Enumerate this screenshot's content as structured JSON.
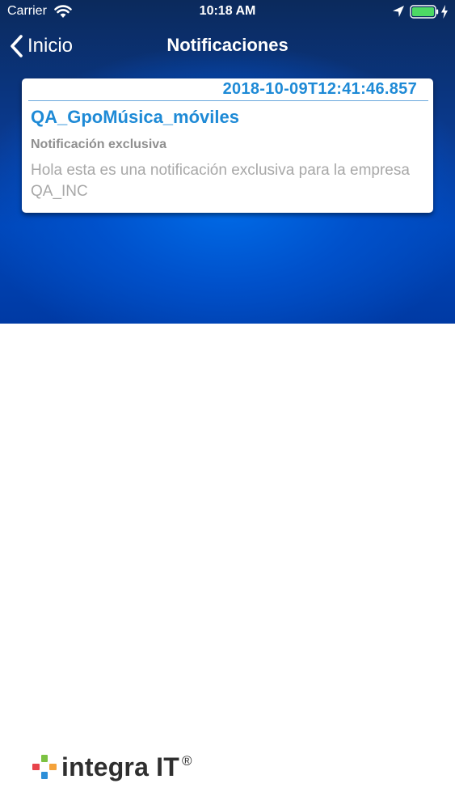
{
  "status_bar": {
    "carrier": "Carrier",
    "time": "10:18 AM",
    "icons": [
      "wifi-icon",
      "location-icon",
      "battery-icon",
      "charge-icon"
    ]
  },
  "nav": {
    "back_label": "Inicio",
    "title": "Notificaciones"
  },
  "notifications": [
    {
      "timestamp": "2018-10-09T12:41:46.857",
      "group": "QA_GpoMúsica_móviles",
      "subject": "Notificación exclusiva",
      "body": "Hola esta es una notificación exclusiva para la empresa QA_INC"
    }
  ],
  "footer": {
    "brand": "integra IT",
    "registered": "®"
  },
  "colors": {
    "accent_blue": "#1e8ad6",
    "nav_background": "#0b2a5c",
    "gradient_blue": "#0052cd",
    "subject_gray": "#8f8f8f",
    "body_gray": "#a8a8a8",
    "logo_dark": "#2f2f2f",
    "logo_green": "#7cc242",
    "logo_red": "#e8434b",
    "logo_orange": "#f4a23a",
    "logo_blue": "#2d8fd8"
  }
}
